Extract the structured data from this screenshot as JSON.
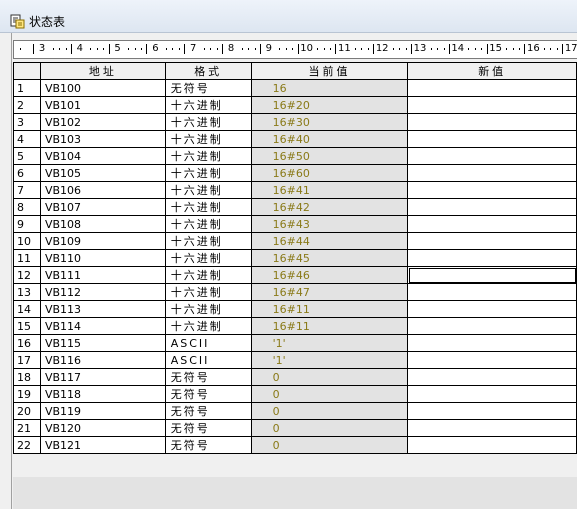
{
  "window": {
    "title": "状态表",
    "icon": "status-table-icon"
  },
  "ruler": {
    "labels": [
      "3",
      "4",
      "5",
      "6",
      "7",
      "8",
      "9",
      "10",
      "11",
      "12",
      "13",
      "14",
      "15",
      "16",
      "17"
    ]
  },
  "table": {
    "columns": {
      "address": "地址",
      "format": "格式",
      "current": "当前值",
      "new": "新值"
    },
    "rows": [
      {
        "n": "1",
        "address": "VB100",
        "format": "无符号",
        "current": "16"
      },
      {
        "n": "2",
        "address": "VB101",
        "format": "十六进制",
        "current": "16#20"
      },
      {
        "n": "3",
        "address": "VB102",
        "format": "十六进制",
        "current": "16#30"
      },
      {
        "n": "4",
        "address": "VB103",
        "format": "十六进制",
        "current": "16#40"
      },
      {
        "n": "5",
        "address": "VB104",
        "format": "十六进制",
        "current": "16#50"
      },
      {
        "n": "6",
        "address": "VB105",
        "format": "十六进制",
        "current": "16#60"
      },
      {
        "n": "7",
        "address": "VB106",
        "format": "十六进制",
        "current": "16#41"
      },
      {
        "n": "8",
        "address": "VB107",
        "format": "十六进制",
        "current": "16#42"
      },
      {
        "n": "9",
        "address": "VB108",
        "format": "十六进制",
        "current": "16#43"
      },
      {
        "n": "10",
        "address": "VB109",
        "format": "十六进制",
        "current": "16#44"
      },
      {
        "n": "11",
        "address": "VB110",
        "format": "十六进制",
        "current": "16#45"
      },
      {
        "n": "12",
        "address": "VB111",
        "format": "十六进制",
        "current": "16#46"
      },
      {
        "n": "13",
        "address": "VB112",
        "format": "十六进制",
        "current": "16#47"
      },
      {
        "n": "14",
        "address": "VB113",
        "format": "十六进制",
        "current": "16#11"
      },
      {
        "n": "15",
        "address": "VB114",
        "format": "十六进制",
        "current": "16#11"
      },
      {
        "n": "16",
        "address": "VB115",
        "format": "ASCII",
        "current": "'1'"
      },
      {
        "n": "17",
        "address": "VB116",
        "format": "ASCII",
        "current": "'1'"
      },
      {
        "n": "18",
        "address": "VB117",
        "format": "无符号",
        "current": "0"
      },
      {
        "n": "19",
        "address": "VB118",
        "format": "无符号",
        "current": "0"
      },
      {
        "n": "20",
        "address": "VB119",
        "format": "无符号",
        "current": "0"
      },
      {
        "n": "21",
        "address": "VB120",
        "format": "无符号",
        "current": "0"
      },
      {
        "n": "22",
        "address": "VB121",
        "format": "无符号",
        "current": "0"
      }
    ],
    "selected_row": "12"
  }
}
